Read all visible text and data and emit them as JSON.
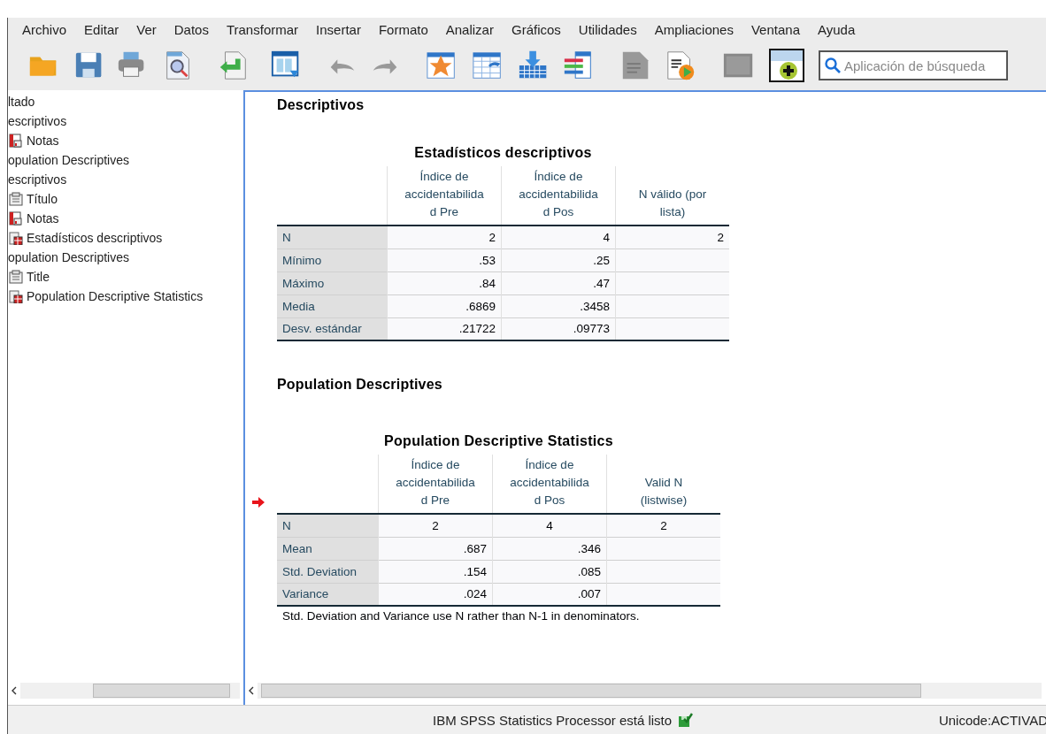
{
  "menu": [
    "Archivo",
    "Editar",
    "Ver",
    "Datos",
    "Transformar",
    "Insertar",
    "Formato",
    "Analizar",
    "Gráficos",
    "Utilidades",
    "Ampliaciones",
    "Ventana",
    "Ayuda"
  ],
  "search": {
    "placeholder": "Aplicación de búsqueda"
  },
  "outline": [
    {
      "label": "ltado",
      "kind": "heading"
    },
    {
      "label": "escriptivos",
      "kind": "heading"
    },
    {
      "label": "Notas",
      "kind": "notes"
    },
    {
      "label": "opulation Descriptives",
      "kind": "heading"
    },
    {
      "label": "escriptivos",
      "kind": "heading"
    },
    {
      "label": "Título",
      "kind": "title"
    },
    {
      "label": "Notas",
      "kind": "notes"
    },
    {
      "label": "Estadísticos descriptivos",
      "kind": "table"
    },
    {
      "label": "opulation Descriptives",
      "kind": "heading"
    },
    {
      "label": "Title",
      "kind": "title"
    },
    {
      "label": "Population Descriptive Statistics",
      "kind": "table"
    }
  ],
  "output": [
    {
      "heading": "Descriptivos",
      "table": {
        "title": "Estadísticos descriptivos",
        "current": false,
        "columns": [
          "Índice de\naccidentabilida\nd Pre",
          "Índice de\naccidentabilida\nd Pos",
          "N válido (por\nlista)"
        ],
        "rows": [
          {
            "label": "N",
            "cells": [
              "2",
              "4",
              "2"
            ],
            "centered": false
          },
          {
            "label": "Mínimo",
            "cells": [
              ".53",
              ".25",
              ""
            ],
            "centered": false
          },
          {
            "label": "Máximo",
            "cells": [
              ".84",
              ".47",
              ""
            ],
            "centered": false
          },
          {
            "label": "Media",
            "cells": [
              ".6869",
              ".3458",
              ""
            ],
            "centered": false
          },
          {
            "label": "Desv. estándar",
            "cells": [
              ".21722",
              ".09773",
              ""
            ],
            "centered": false
          }
        ]
      }
    },
    {
      "heading": "Population Descriptives",
      "table": {
        "title": "Population Descriptive Statistics",
        "current": true,
        "columns": [
          "Índice de\naccidentabilida\nd Pre",
          "Índice de\naccidentabilida\nd Pos",
          "Valid N\n(listwise)"
        ],
        "rows": [
          {
            "label": "N",
            "cells": [
              "2",
              "4",
              "2"
            ],
            "centered": true
          },
          {
            "label": "Mean",
            "cells": [
              ".687",
              ".346",
              ""
            ],
            "centered": false
          },
          {
            "label": "Std. Deviation",
            "cells": [
              ".154",
              ".085",
              ""
            ],
            "centered": false
          },
          {
            "label": "Variance",
            "cells": [
              ".024",
              ".007",
              ""
            ],
            "centered": false
          }
        ],
        "footnote": "Std. Deviation and Variance use N rather than N-1 in denominators."
      }
    }
  ],
  "status_bar": {
    "message": "IBM SPSS Statistics Processor está listo",
    "encoding": "Unicode:ACTIVAD"
  }
}
